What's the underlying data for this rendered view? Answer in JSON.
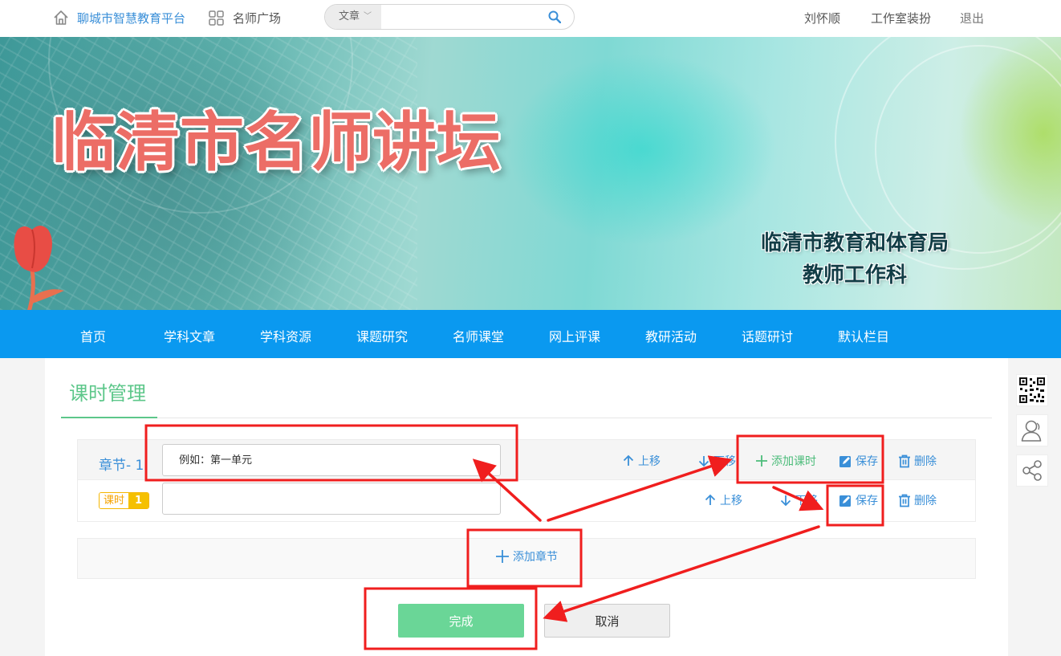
{
  "topbar": {
    "platform_name": "聊城市智慧教育平台",
    "plaza": "名师广场",
    "search_type": "文章",
    "search_value": "",
    "user_name": "刘怀顺",
    "studio_decor": "工作室装扮",
    "logout": "退出"
  },
  "banner": {
    "title": "临清市名师讲坛",
    "subtitle_line1": "临清市教育和体育局",
    "subtitle_line2": "教师工作科"
  },
  "nav": {
    "items": [
      "首页",
      "学科文章",
      "学科资源",
      "课题研究",
      "名师课堂",
      "网上评课",
      "教研活动",
      "话题研讨",
      "默认栏目"
    ]
  },
  "page": {
    "title": "课时管理"
  },
  "chapter": {
    "label": "章节- 1",
    "placeholder": "例如：第一单元",
    "value": "",
    "move_up": "上移",
    "move_down": "下移",
    "add_lesson": "添加课时",
    "save": "保存",
    "delete": "删除"
  },
  "lesson": {
    "badge_text": "课时",
    "badge_num": "1",
    "value": "",
    "move_up": "上移",
    "move_down": "下移",
    "save": "保存",
    "delete": "删除"
  },
  "add_chapter": "添加章节",
  "buttons": {
    "done": "完成",
    "cancel": "取消"
  },
  "side_tools": [
    "qr-code-icon",
    "contact-icon",
    "share-icon"
  ],
  "colors": {
    "nav_blue": "#0a99f0",
    "link_blue": "#3a8fd8",
    "accent_green": "#5dc78a",
    "done_green": "#6ad697",
    "annotation_red": "#f01e1e",
    "title_coral": "#ec6d66"
  }
}
